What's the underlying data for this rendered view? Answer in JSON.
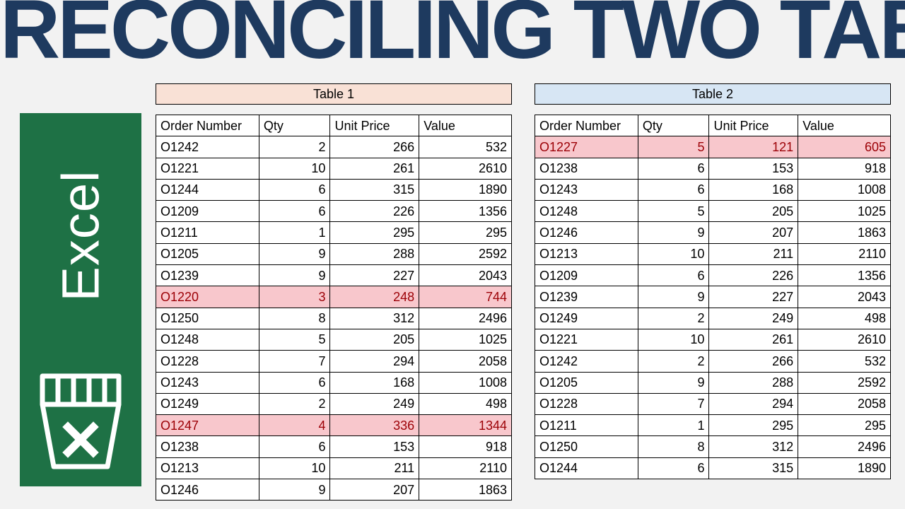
{
  "headline": "RECONCILING TWO TABLES",
  "badge_text": "Excel",
  "tables": [
    {
      "caption": "Table 1",
      "caption_class": "c1",
      "columns": [
        "Order Number",
        "Qty",
        "Unit Price",
        "Value"
      ],
      "rows": [
        {
          "order": "O1242",
          "qty": 2,
          "price": 266,
          "value": 532,
          "hl": false
        },
        {
          "order": "O1221",
          "qty": 10,
          "price": 261,
          "value": 2610,
          "hl": false
        },
        {
          "order": "O1244",
          "qty": 6,
          "price": 315,
          "value": 1890,
          "hl": false
        },
        {
          "order": "O1209",
          "qty": 6,
          "price": 226,
          "value": 1356,
          "hl": false
        },
        {
          "order": "O1211",
          "qty": 1,
          "price": 295,
          "value": 295,
          "hl": false
        },
        {
          "order": "O1205",
          "qty": 9,
          "price": 288,
          "value": 2592,
          "hl": false
        },
        {
          "order": "O1239",
          "qty": 9,
          "price": 227,
          "value": 2043,
          "hl": false
        },
        {
          "order": "O1220",
          "qty": 3,
          "price": 248,
          "value": 744,
          "hl": true
        },
        {
          "order": "O1250",
          "qty": 8,
          "price": 312,
          "value": 2496,
          "hl": false
        },
        {
          "order": "O1248",
          "qty": 5,
          "price": 205,
          "value": 1025,
          "hl": false
        },
        {
          "order": "O1228",
          "qty": 7,
          "price": 294,
          "value": 2058,
          "hl": false
        },
        {
          "order": "O1243",
          "qty": 6,
          "price": 168,
          "value": 1008,
          "hl": false
        },
        {
          "order": "O1249",
          "qty": 2,
          "price": 249,
          "value": 498,
          "hl": false
        },
        {
          "order": "O1247",
          "qty": 4,
          "price": 336,
          "value": 1344,
          "hl": true
        },
        {
          "order": "O1238",
          "qty": 6,
          "price": 153,
          "value": 918,
          "hl": false
        },
        {
          "order": "O1213",
          "qty": 10,
          "price": 211,
          "value": 2110,
          "hl": false
        },
        {
          "order": "O1246",
          "qty": 9,
          "price": 207,
          "value": 1863,
          "hl": false
        }
      ]
    },
    {
      "caption": "Table 2",
      "caption_class": "c2",
      "columns": [
        "Order Number",
        "Qty",
        "Unit Price",
        "Value"
      ],
      "rows": [
        {
          "order": "O1227",
          "qty": 5,
          "price": 121,
          "value": 605,
          "hl": true
        },
        {
          "order": "O1238",
          "qty": 6,
          "price": 153,
          "value": 918,
          "hl": false
        },
        {
          "order": "O1243",
          "qty": 6,
          "price": 168,
          "value": 1008,
          "hl": false
        },
        {
          "order": "O1248",
          "qty": 5,
          "price": 205,
          "value": 1025,
          "hl": false
        },
        {
          "order": "O1246",
          "qty": 9,
          "price": 207,
          "value": 1863,
          "hl": false
        },
        {
          "order": "O1213",
          "qty": 10,
          "price": 211,
          "value": 2110,
          "hl": false
        },
        {
          "order": "O1209",
          "qty": 6,
          "price": 226,
          "value": 1356,
          "hl": false
        },
        {
          "order": "O1239",
          "qty": 9,
          "price": 227,
          "value": 2043,
          "hl": false
        },
        {
          "order": "O1249",
          "qty": 2,
          "price": 249,
          "value": 498,
          "hl": false
        },
        {
          "order": "O1221",
          "qty": 10,
          "price": 261,
          "value": 2610,
          "hl": false
        },
        {
          "order": "O1242",
          "qty": 2,
          "price": 266,
          "value": 532,
          "hl": false
        },
        {
          "order": "O1205",
          "qty": 9,
          "price": 288,
          "value": 2592,
          "hl": false
        },
        {
          "order": "O1228",
          "qty": 7,
          "price": 294,
          "value": 2058,
          "hl": false
        },
        {
          "order": "O1211",
          "qty": 1,
          "price": 295,
          "value": 295,
          "hl": false
        },
        {
          "order": "O1250",
          "qty": 8,
          "price": 312,
          "value": 2496,
          "hl": false
        },
        {
          "order": "O1244",
          "qty": 6,
          "price": 315,
          "value": 1890,
          "hl": false
        }
      ]
    }
  ]
}
